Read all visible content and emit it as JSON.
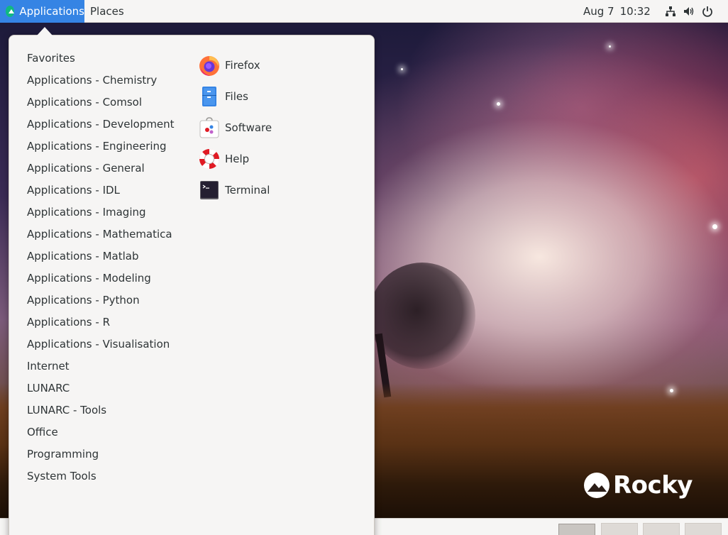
{
  "topbar": {
    "applications_label": "Applications",
    "places_label": "Places",
    "date": "Aug 7",
    "time": "10:32",
    "tray_icons": [
      "network-icon",
      "volume-icon",
      "power-icon"
    ]
  },
  "menu": {
    "categories": [
      "Favorites",
      "Applications - Chemistry",
      "Applications - Comsol",
      "Applications - Development",
      "Applications - Engineering",
      "Applications - General",
      "Applications - IDL",
      "Applications - Imaging",
      "Applications - Mathematica",
      "Applications - Matlab",
      "Applications - Modeling",
      "Applications - Python",
      "Applications - R",
      "Applications - Visualisation",
      "Internet",
      "LUNARC",
      "LUNARC - Tools",
      "Office",
      "Programming",
      "System Tools"
    ],
    "apps": [
      {
        "label": "Firefox",
        "icon": "firefox-icon"
      },
      {
        "label": "Files",
        "icon": "files-icon"
      },
      {
        "label": "Software",
        "icon": "software-icon"
      },
      {
        "label": "Help",
        "icon": "help-icon"
      },
      {
        "label": "Terminal",
        "icon": "terminal-icon"
      }
    ]
  },
  "desktop": {
    "logo_text": "Rocky"
  },
  "workspaces": {
    "count": 4,
    "active_index": 0
  },
  "colors": {
    "accent": "#3584e4",
    "panel_bg": "#f6f5f4",
    "text": "#2e3436"
  }
}
